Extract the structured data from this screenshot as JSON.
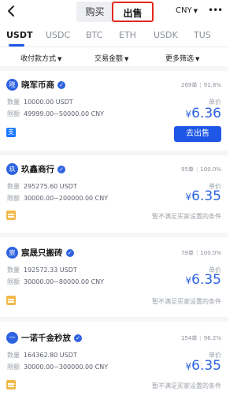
{
  "header": {
    "buy_label": "购买",
    "sell_label": "出售",
    "currency_label": "CNY",
    "more_label": "•••"
  },
  "tabs": [
    {
      "label": "USDT",
      "active": true
    },
    {
      "label": "USDC"
    },
    {
      "label": "BTC"
    },
    {
      "label": "ETH"
    },
    {
      "label": "USDK"
    },
    {
      "label": "TUS"
    }
  ],
  "filters": [
    {
      "label": "收付款方式"
    },
    {
      "label": "交易金额"
    },
    {
      "label": "更多筛选"
    }
  ],
  "labels": {
    "quantity": "数量",
    "limit": "限额",
    "unit_price": "单价",
    "sell_button": "去出售",
    "unmet_notice": "暂不满足买家设置的条件"
  },
  "merchants": [
    {
      "avatar": "晓",
      "name": "晓军币商",
      "orders": "269单",
      "rate": "91.8%",
      "quantity": "10000.00 USDT",
      "limit": "49999.00~50000.00 CNY",
      "price": "6.36",
      "payment_icon": "alipay-icon",
      "action": "sell-button"
    },
    {
      "avatar": "玖",
      "name": "玖鑫商行",
      "orders": "95单",
      "rate": "100.0%",
      "quantity": "295275.60 USDT",
      "limit": "30000.00~200000.00 CNY",
      "price": "6.35",
      "payment_icon": "bank-card-icon",
      "action": "notice"
    },
    {
      "avatar": "宸",
      "name": "宸晟只搬砖",
      "orders": "79单",
      "rate": "100.0%",
      "quantity": "192572.33 USDT",
      "limit": "30000.00~80000.00 CNY",
      "price": "6.35",
      "payment_icon": "bank-card-icon",
      "action": "notice"
    },
    {
      "avatar": "一",
      "name": "一诺千金秒放",
      "orders": "154单",
      "rate": "96.2%",
      "quantity": "164362.80 USDT",
      "limit": "30000.00~300000.00 CNY",
      "price": "6.35",
      "payment_icon": "bank-card-icon",
      "action": "notice"
    }
  ],
  "colors": {
    "accent": "#1e56e6",
    "sell_highlight": "#e2281f",
    "price": "#2e63e0"
  }
}
